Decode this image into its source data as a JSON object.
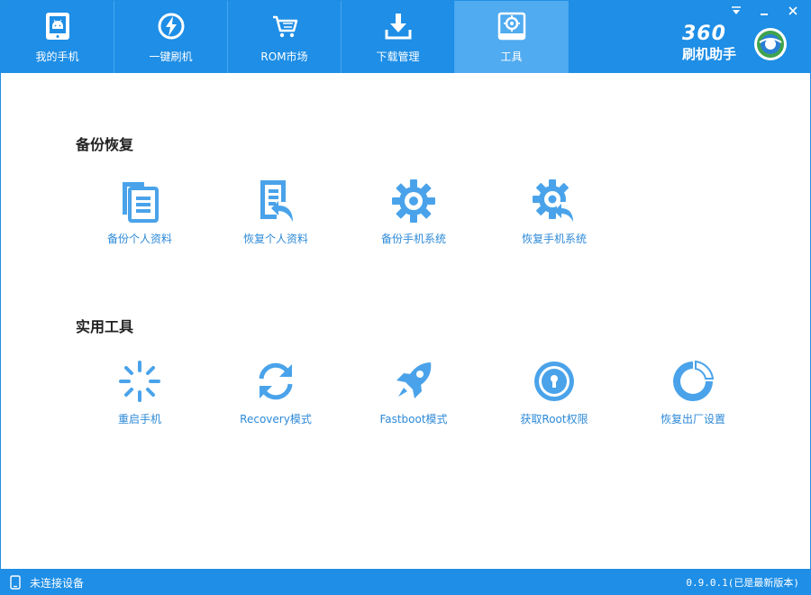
{
  "tabs": [
    {
      "label": "我的手机",
      "icon": "phone-android-icon",
      "active": false
    },
    {
      "label": "一键刷机",
      "icon": "flash-circle-icon",
      "active": false
    },
    {
      "label": "ROM市场",
      "icon": "shopping-cart-icon",
      "active": false
    },
    {
      "label": "下载管理",
      "icon": "download-icon",
      "active": false
    },
    {
      "label": "工具",
      "icon": "toolbox-icon",
      "active": true
    }
  ],
  "logo": {
    "number": "360",
    "name": "刷机助手"
  },
  "sections": {
    "backup": {
      "title": "备份恢复",
      "items": [
        {
          "label": "备份个人资料",
          "icon": "backup-data-icon"
        },
        {
          "label": "恢复个人资料",
          "icon": "restore-data-icon"
        },
        {
          "label": "备份手机系统",
          "icon": "backup-system-gear-icon"
        },
        {
          "label": "恢复手机系统",
          "icon": "restore-system-gear-icon"
        }
      ]
    },
    "tools": {
      "title": "实用工具",
      "items": [
        {
          "label": "重启手机",
          "icon": "reboot-spinner-icon"
        },
        {
          "label": "Recovery模式",
          "icon": "recovery-refresh-icon"
        },
        {
          "label": "Fastboot模式",
          "icon": "rocket-icon"
        },
        {
          "label": "获取Root权限",
          "icon": "root-lock-icon"
        },
        {
          "label": "恢复出厂设置",
          "icon": "factory-reset-pie-icon"
        }
      ]
    }
  },
  "status": {
    "device": "未连接设备",
    "version": "0.9.0.1(已是最新版本)"
  },
  "colors": {
    "brand": "#1e8ee6",
    "active_tab": "#50abf0",
    "icon": "#4aa3ea",
    "label": "#2d8ad8"
  }
}
